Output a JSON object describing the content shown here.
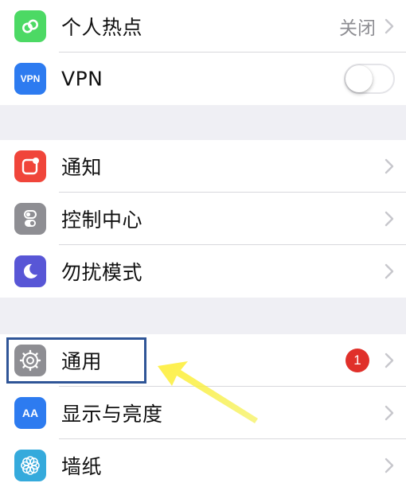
{
  "groups": [
    {
      "items": [
        {
          "label": "个人热点",
          "value": "关闭",
          "icon": "hotspot-icon",
          "icon_color": "#4cd964"
        },
        {
          "label": "VPN",
          "icon": "vpn-icon",
          "icon_text": "VPN",
          "icon_color": "#2d7bf0",
          "toggle_on": false
        }
      ]
    },
    {
      "items": [
        {
          "label": "通知",
          "icon": "notification-icon",
          "icon_color": "#f0453a"
        },
        {
          "label": "控制中心",
          "icon": "control-center-icon",
          "icon_color": "#8e8e93"
        },
        {
          "label": "勿扰模式",
          "icon": "moon-icon",
          "icon_color": "#5856d6"
        }
      ]
    },
    {
      "items": [
        {
          "label": "通用",
          "icon": "gear-icon",
          "icon_color": "#8e8e93",
          "badge": "1"
        },
        {
          "label": "显示与亮度",
          "icon": "display-brightness-icon",
          "icon_text": "AA",
          "icon_color": "#2d7bf0"
        },
        {
          "label": "墙纸",
          "icon": "wallpaper-icon",
          "icon_color": "#35aadc"
        }
      ]
    }
  ],
  "colors": {
    "highlight_border": "#2f5597",
    "arrow": "#f5f02a",
    "badge": "#e0302a"
  }
}
